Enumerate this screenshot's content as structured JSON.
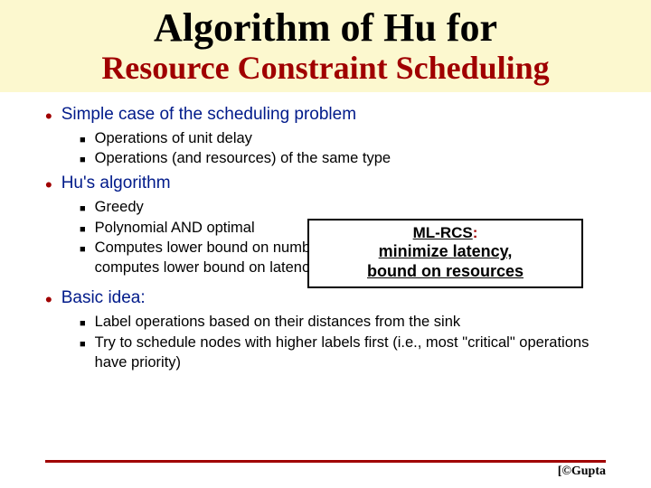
{
  "title": {
    "line1": "Algorithm of Hu for",
    "line2": "Resource Constraint Scheduling"
  },
  "sections": [
    {
      "heading": "Simple case of the scheduling problem",
      "items": [
        "Operations of unit delay",
        "Operations (and resources) of the same type"
      ]
    },
    {
      "heading": "Hu's algorithm",
      "items": [
        "Greedy",
        "Polynomial AND optimal",
        "Computes lower bound on number of resources for a given latency\nOR: computes lower bound on latency subject to resource constraints"
      ]
    },
    {
      "heading": "Basic idea:",
      "items": [
        "Label operations based on their distances from the sink",
        "Try to schedule nodes with higher labels first (i.e., most \"critical\" operations have priority)"
      ]
    }
  ],
  "callout": {
    "label": "ML-RCS",
    "colon": ":",
    "line1": "minimize latency,",
    "line2": "bound on resources"
  },
  "credit": "[©Gupta"
}
